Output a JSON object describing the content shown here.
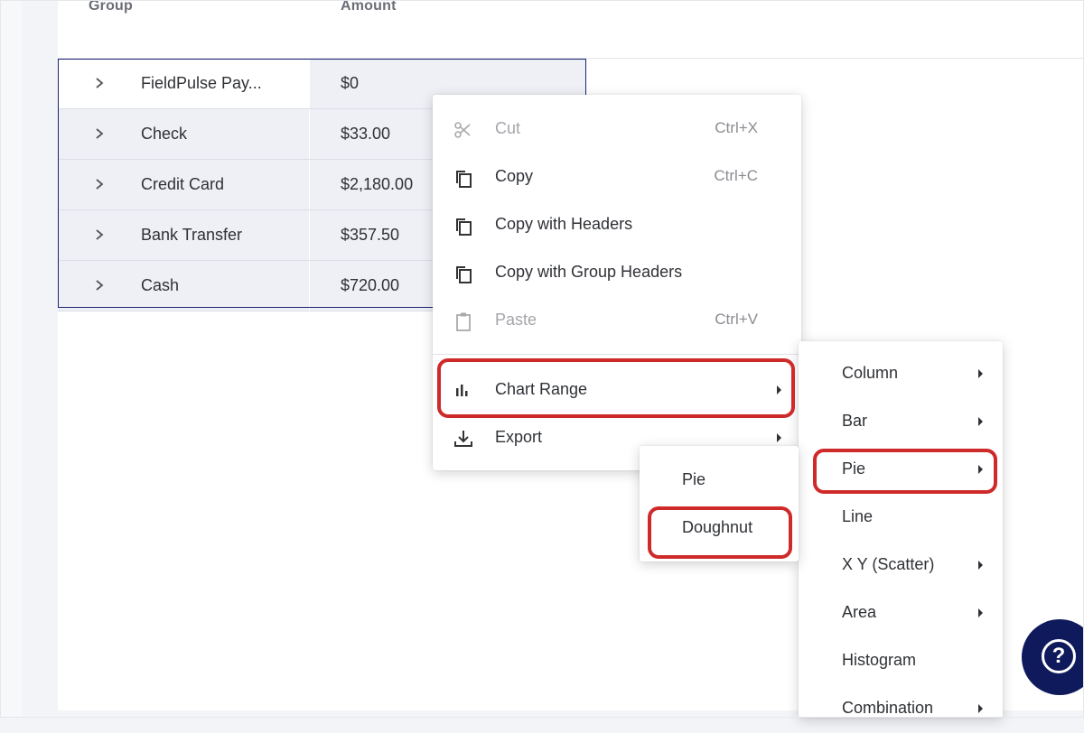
{
  "grid": {
    "headers": {
      "group": "Group",
      "amount": "Amount"
    },
    "rows": [
      {
        "group": "FieldPulse Pay...",
        "amount": "$0"
      },
      {
        "group": "Check",
        "amount": "$33.00"
      },
      {
        "group": "Credit Card",
        "amount": "$2,180.00"
      },
      {
        "group": "Bank Transfer",
        "amount": "$357.50"
      },
      {
        "group": "Cash",
        "amount": "$720.00"
      }
    ]
  },
  "context_menu": {
    "items": [
      {
        "label": "Cut",
        "shortcut": "Ctrl+X",
        "icon": "scissors-icon",
        "disabled": true
      },
      {
        "label": "Copy",
        "shortcut": "Ctrl+C",
        "icon": "copy-icon",
        "disabled": false
      },
      {
        "label": "Copy with Headers",
        "shortcut": "",
        "icon": "copy-icon",
        "disabled": false
      },
      {
        "label": "Copy with Group Headers",
        "shortcut": "",
        "icon": "copy-icon",
        "disabled": false
      },
      {
        "label": "Paste",
        "shortcut": "Ctrl+V",
        "icon": "clipboard-icon",
        "disabled": true
      },
      {
        "label": "Chart Range",
        "shortcut": "",
        "icon": "bar-chart-icon",
        "submenu": true
      },
      {
        "label": "Export",
        "shortcut": "",
        "icon": "download-icon",
        "submenu": true
      }
    ]
  },
  "chart_submenu": {
    "items": [
      {
        "label": "Column",
        "submenu": true
      },
      {
        "label": "Bar",
        "submenu": true
      },
      {
        "label": "Pie",
        "submenu": true
      },
      {
        "label": "Line",
        "submenu": false
      },
      {
        "label": "X Y (Scatter)",
        "submenu": true
      },
      {
        "label": "Area",
        "submenu": true
      },
      {
        "label": "Histogram",
        "submenu": false
      },
      {
        "label": "Combination",
        "submenu": true
      }
    ]
  },
  "pie_submenu": {
    "items": [
      {
        "label": "Pie"
      },
      {
        "label": "Doughnut"
      }
    ]
  },
  "help": {
    "glyph": "?"
  },
  "colors": {
    "highlight": "#cf2a2a",
    "selection_border": "#1a2472",
    "help_button": "#0f1a5c",
    "row_bg": "#eff0f6"
  }
}
